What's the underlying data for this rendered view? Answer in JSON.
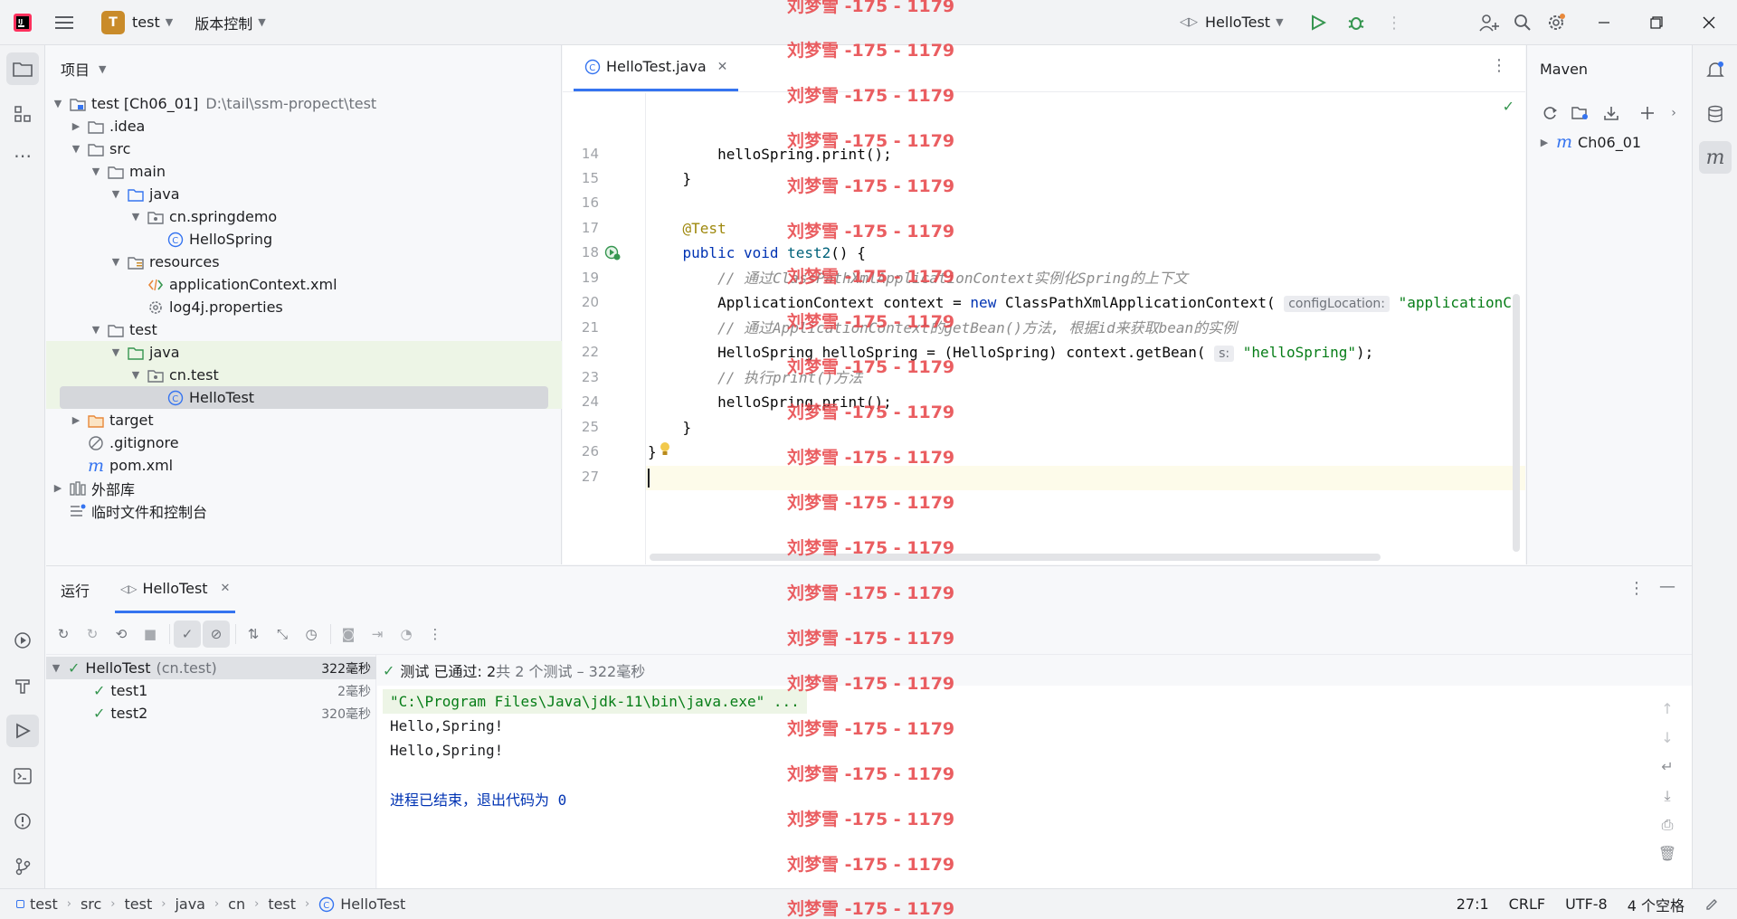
{
  "titlebar": {
    "project_badge": "T",
    "project_name": "test",
    "vcs_label": "版本控制",
    "run_config": "HelloTest"
  },
  "project_panel": {
    "title": "项目",
    "tree": [
      {
        "label": "test [Ch06_01]",
        "extra": "D:\\tail\\ssm-propect\\test",
        "icon": "module-folder-icon"
      },
      {
        "label": ".idea",
        "icon": "folder-icon"
      },
      {
        "label": "src",
        "icon": "folder-icon"
      },
      {
        "label": "main",
        "icon": "folder-icon"
      },
      {
        "label": "java",
        "icon": "source-folder-icon"
      },
      {
        "label": "cn.springdemo",
        "icon": "package-icon"
      },
      {
        "label": "HelloSpring",
        "icon": "class-icon"
      },
      {
        "label": "resources",
        "icon": "resources-folder-icon"
      },
      {
        "label": "applicationContext.xml",
        "icon": "xml-file-icon"
      },
      {
        "label": "log4j.properties",
        "icon": "properties-file-icon"
      },
      {
        "label": "test",
        "icon": "folder-icon"
      },
      {
        "label": "java",
        "icon": "test-source-folder-icon"
      },
      {
        "label": "cn.test",
        "icon": "package-icon"
      },
      {
        "label": "HelloTest",
        "icon": "class-icon"
      },
      {
        "label": "target",
        "icon": "excluded-folder-icon"
      },
      {
        "label": ".gitignore",
        "icon": "ignore-file-icon"
      },
      {
        "label": "pom.xml",
        "icon": "maven-file-icon"
      },
      {
        "label": "外部库",
        "icon": "library-icon"
      },
      {
        "label": "临时文件和控制台",
        "icon": "scratch-icon"
      }
    ]
  },
  "editor": {
    "tab_label": "HelloTest.java",
    "line_numbers": [
      "14",
      "15",
      "16",
      "17",
      "18",
      "19",
      "20",
      "21",
      "22",
      "23",
      "24",
      "25",
      "26",
      "27"
    ],
    "code": {
      "l14": "        helloSpring.print();",
      "l15": "    }",
      "l17_ann": "@Test",
      "l18_a": "    public void ",
      "l18_fn": "test2",
      "l18_b": "() {",
      "l19": "        // 通过ClassPathXmlApplicationContext实例化Spring的上下文",
      "l20_a": "        ApplicationContext context = ",
      "l20_new": "new",
      "l20_b": " ClassPathXmlApplicationContext( ",
      "l20_hint": "configLocation:",
      "l20_str": " \"applicationC",
      "l21": "        // 通过ApplicationContext的getBean()方法, 根据id来获取bean的实例",
      "l22_a": "        HelloSpring helloSpring = (HelloSpring) context.getBean( ",
      "l22_hint": "s:",
      "l22_str": " \"helloSpring\"",
      "l22_b": ");",
      "l23": "        // 执行print()方法",
      "l24": "        helloSpring.print();",
      "l25": "    }",
      "l26": "}"
    }
  },
  "maven": {
    "title": "Maven",
    "root_item": "Ch06_01"
  },
  "run_panel": {
    "title": "运行",
    "tab_label": "HelloTest",
    "tests": [
      {
        "name": "HelloTest",
        "extra": "(cn.test)",
        "duration": "322毫秒"
      },
      {
        "name": "test1",
        "duration": "2毫秒"
      },
      {
        "name": "test2",
        "duration": "320毫秒"
      }
    ],
    "summary_prefix": "测试 已通过: 2",
    "summary_suffix": "共 2 个测试 – 322毫秒",
    "console": [
      "\"C:\\Program Files\\Java\\jdk-11\\bin\\java.exe\" ...",
      "Hello,Spring!",
      "Hello,Spring!",
      "",
      "进程已结束，退出代码为 0"
    ]
  },
  "statusbar": {
    "breadcrumbs": [
      "test",
      "src",
      "test",
      "java",
      "cn",
      "test",
      "HelloTest"
    ],
    "position": "27:1",
    "line_sep": "CRLF",
    "encoding": "UTF-8",
    "indent": "4 个空格"
  },
  "watermark": {
    "text": "刘梦雪 -175 - 1179"
  },
  "colors": {
    "accent": "#3574f0",
    "pass": "#369650",
    "watermark": "#e8484c"
  }
}
